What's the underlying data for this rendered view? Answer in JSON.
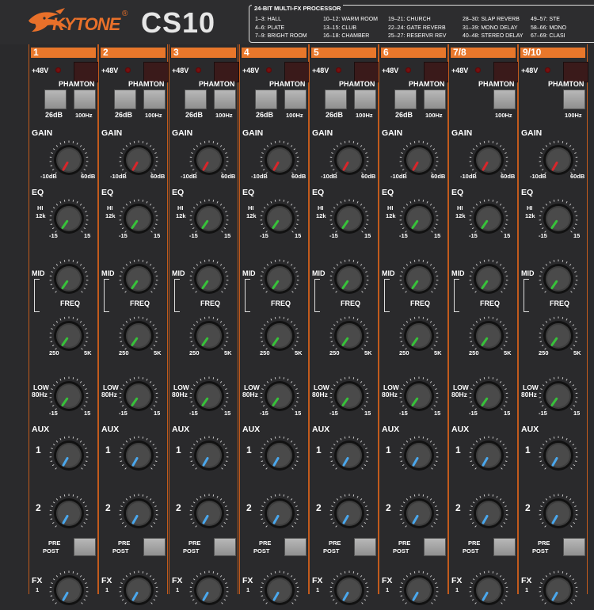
{
  "brand": {
    "name": "KYTONE",
    "reg": "®",
    "model": "CS10"
  },
  "fx": {
    "title": "24-BIT MULTI-FX PROCESSOR",
    "columns": [
      [
        "1–3: HALL",
        "4–6: PLATE",
        "7–9: BRIGHT ROOM"
      ],
      [
        "10–12: WARM ROOM",
        "13–15: CLUB",
        "16–18: CHAMBER"
      ],
      [
        "19–21: CHURCH",
        "22–24: GATE REVERB",
        "25–27: RESERVR REV"
      ],
      [
        "28–30: SLAP REVERB",
        "31–39: MONO DELAY",
        "40–48: STEREO DELAY"
      ],
      [
        "49–57: STE",
        "58–66: MONO",
        "67–69: CLASI"
      ]
    ]
  },
  "labels": {
    "phantom": "+48V",
    "phamton": "PHAMTON",
    "pad": "26dB",
    "hpf": "100Hz",
    "gain": "GAIN",
    "gain_min": "-10dB",
    "gain_max": "60dB",
    "eq": "EQ",
    "hi": "HI",
    "hi_freq": "12k",
    "eq_min": "-15",
    "eq_max": "15",
    "mid": "MID",
    "freq": "FREQ",
    "freq_min": "250",
    "freq_max": "5K",
    "low": "LOW",
    "low_freq": "80Hz",
    "aux": "AUX",
    "aux1": "1",
    "aux2": "2",
    "pre": "PRE",
    "post": "POST",
    "fx": "FX",
    "fx1": "1"
  },
  "channels": [
    {
      "label": "1",
      "mono": true
    },
    {
      "label": "2",
      "mono": true
    },
    {
      "label": "3",
      "mono": true
    },
    {
      "label": "4",
      "mono": true
    },
    {
      "label": "5",
      "mono": true
    },
    {
      "label": "6",
      "mono": true
    },
    {
      "label": "7/8",
      "mono": false
    },
    {
      "label": "9/10",
      "mono": false
    }
  ],
  "colors": {
    "accent": "#e8772b",
    "gain_pointer": "#d8262b",
    "eq_pointer": "#37c23a",
    "aux_pointer": "#4aa8ee"
  }
}
